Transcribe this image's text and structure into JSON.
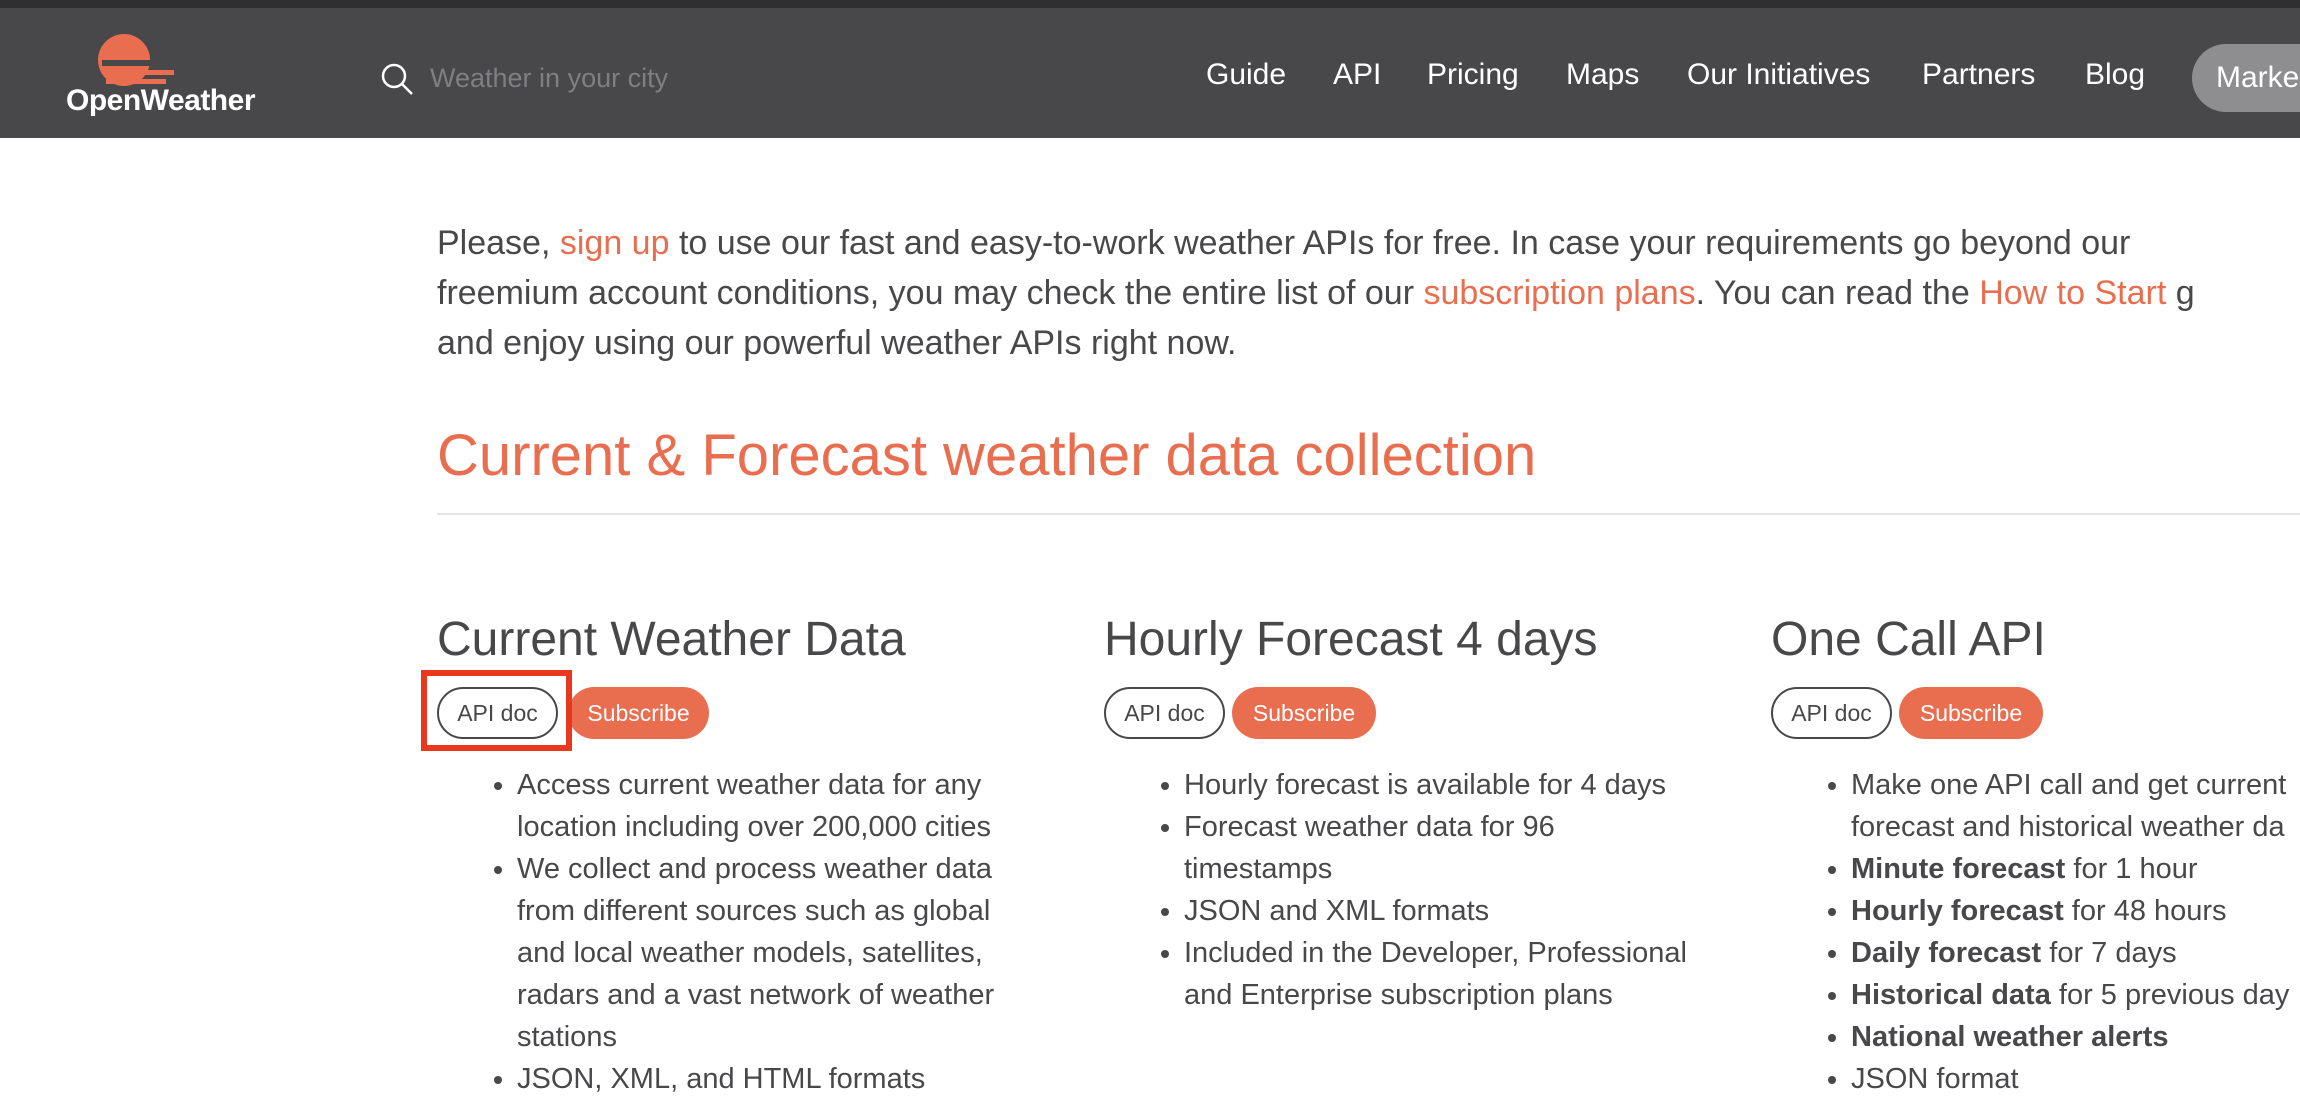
{
  "header": {
    "logo_text": "OpenWeather",
    "search_placeholder": "Weather in your city",
    "nav": [
      "Guide",
      "API",
      "Pricing",
      "Maps",
      "Our Initiatives",
      "Partners",
      "Blog"
    ],
    "market_button": "Marke"
  },
  "intro": {
    "l1_a": "Please, ",
    "l1_link": "sign up",
    "l1_b": " to use our fast and easy-to-work weather APIs for free. In case your requirements go beyond our",
    "l2_a": "freemium account conditions, you may check the entire list of our ",
    "l2_link1": "subscription plans",
    "l2_b": ". You can read the ",
    "l2_link2": "How to Start",
    "l2_c": " g",
    "l3": "and enjoy using our powerful weather APIs right now."
  },
  "section_title": "Current & Forecast weather data collection",
  "cards": [
    {
      "title": "Current Weather Data",
      "api_doc": "API doc",
      "subscribe": "Subscribe",
      "bullets": [
        [
          "Access current weather data for any",
          "location including over 200,000 cities"
        ],
        [
          "We collect and process weather data",
          "from different sources such as global",
          "and local weather models, satellites,",
          "radars and a vast network of weather",
          "stations"
        ],
        [
          "JSON, XML, and HTML formats"
        ]
      ]
    },
    {
      "title": "Hourly Forecast 4 days",
      "api_doc": "API doc",
      "subscribe": "Subscribe",
      "bullets": [
        [
          "Hourly forecast is available for 4 days"
        ],
        [
          "Forecast weather data for 96",
          "timestamps"
        ],
        [
          "JSON and XML formats"
        ],
        [
          "Included in the Developer, Professional",
          "and Enterprise subscription plans"
        ]
      ]
    },
    {
      "title": "One Call API",
      "api_doc": "API doc",
      "subscribe": "Subscribe",
      "b1": [
        "Make one API call and get current",
        "forecast and historical weather da"
      ],
      "b2_bold": "Minute forecast",
      "b2_rest": " for 1 hour",
      "b3_bold": "Hourly forecast",
      "b3_rest": " for 48 hours",
      "b4_bold": "Daily forecast",
      "b4_rest": " for 7 days",
      "b5_bold": "Historical data",
      "b5_rest": " for 5 previous day",
      "b6_bold": "National weather alerts",
      "b7": "JSON format"
    }
  ],
  "colors": {
    "accent": "#e96e50",
    "header_bg": "#48484a",
    "highlight": "#e8391f"
  }
}
